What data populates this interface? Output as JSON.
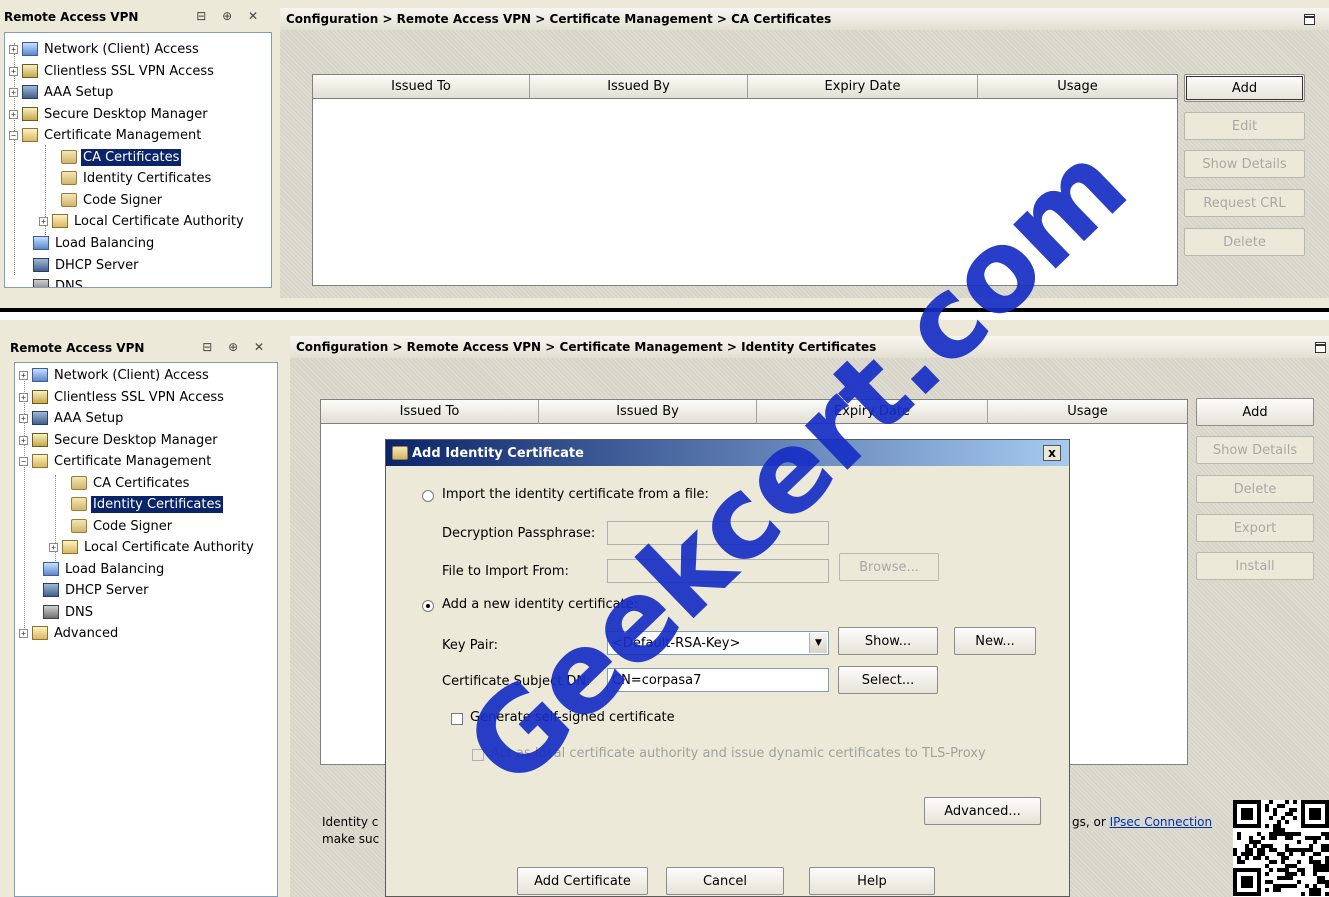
{
  "top": {
    "nav_title": "Remote Access VPN",
    "nav_ctrls": "⊟ ⊕ ✕",
    "tree": [
      "Network (Client) Access",
      "Clientless SSL VPN Access",
      "AAA Setup",
      "Secure Desktop Manager",
      "Certificate Management",
      "CA Certificates",
      "Identity Certificates",
      "Code Signer",
      "Local Certificate Authority",
      "Load Balancing",
      "DHCP Server",
      "DNS"
    ],
    "breadcrumb": "Configuration > Remote Access VPN > Certificate Management > CA Certificates",
    "columns": [
      "Issued To",
      "Issued By",
      "Expiry Date",
      "Usage"
    ],
    "buttons": [
      "Add",
      "Edit",
      "Show Details",
      "Request CRL",
      "Delete"
    ]
  },
  "bottom": {
    "nav_title": "Remote Access VPN",
    "nav_ctrls": "⊟ ⊕ ✕",
    "tree": [
      "Network (Client) Access",
      "Clientless SSL VPN Access",
      "AAA Setup",
      "Secure Desktop Manager",
      "Certificate Management",
      "CA Certificates",
      "Identity Certificates",
      "Code Signer",
      "Local Certificate Authority",
      "Load Balancing",
      "DHCP Server",
      "DNS",
      "Advanced"
    ],
    "breadcrumb": "Configuration > Remote Access VPN > Certificate Management > Identity Certificates",
    "columns": [
      "Issued To",
      "Issued By",
      "Expiry Date",
      "Usage"
    ],
    "buttons": [
      "Add",
      "Show Details",
      "Delete",
      "Export",
      "Install"
    ],
    "footer_line1": "Identity c",
    "footer_line2": "make suc",
    "footer_right_prefix": "gs, or ",
    "footer_link": "IPsec Connection"
  },
  "dialog": {
    "title": "Add Identity Certificate",
    "close": "x",
    "import_radio_label": "Import the identity certificate from a file:",
    "passphrase_label": "Decryption Passphrase:",
    "file_label": "File to Import From:",
    "browse_label": "Browse...",
    "add_new_radio_label": "Add a new identity certificate:",
    "key_pair_label": "Key Pair:",
    "key_pair_value": "<Default-RSA-Key>",
    "show_label": "Show...",
    "new_label": "New...",
    "subject_dn_label": "Certificate Subject DN:",
    "subject_dn_value": "CN=corpasa7",
    "select_label": "Select...",
    "self_signed_label": "Generate self-signed certificate",
    "local_ca_label": "Act as local certificate authority and issue dynamic certificates to TLS-Proxy",
    "advanced_label": "Advanced...",
    "add_certificate_label": "Add Certificate",
    "cancel_label": "Cancel",
    "help_label": "Help"
  },
  "watermark": "Geekcert.com",
  "colors": {
    "selection": "#0a246a",
    "watermark": "#162ec4",
    "panel": "#ece9d8"
  }
}
